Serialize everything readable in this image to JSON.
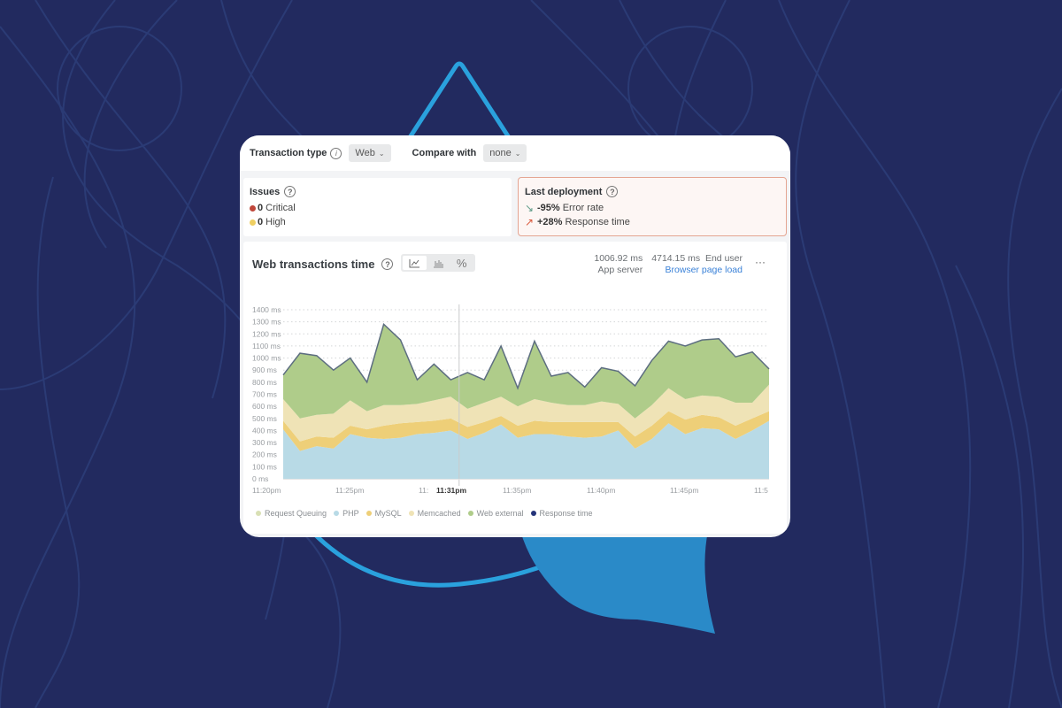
{
  "toolbar": {
    "transaction_type_label": "Transaction type",
    "transaction_type_value": "Web",
    "compare_label": "Compare with",
    "compare_value": "none"
  },
  "issues": {
    "title": "Issues",
    "items": [
      {
        "count": "0",
        "label": "Critical",
        "color": "#c0473a"
      },
      {
        "count": "0",
        "label": "High",
        "color": "#efcf62"
      }
    ]
  },
  "deployment": {
    "title": "Last deployment",
    "items": [
      {
        "arrow": "↘",
        "value": "-95%",
        "label": "Error rate",
        "color": "#5d9a86"
      },
      {
        "arrow": "↗",
        "value": "+28%",
        "label": "Response time",
        "color": "#d9593c"
      }
    ]
  },
  "chart_panel": {
    "title": "Web transactions time",
    "viz_options": [
      "line-chart-icon",
      "bar-chart-icon",
      "percent-icon"
    ],
    "metrics": [
      {
        "value": "1006.92 ms",
        "label": "App server",
        "link": false
      },
      {
        "value": "4714.15 ms  End user",
        "label": "Browser page load",
        "link": true
      }
    ],
    "more_label": "···"
  },
  "chart_data": {
    "type": "area",
    "stacked": true,
    "title": "Web transactions time",
    "ylabel": "",
    "ylim": [
      0,
      1400
    ],
    "yticks": [
      0,
      100,
      200,
      300,
      400,
      500,
      600,
      700,
      800,
      900,
      1000,
      1100,
      1200,
      1300,
      1400
    ],
    "ytick_unit": " ms",
    "xtick_labels": [
      "11:20pm",
      "11:25pm",
      "11:",
      "11:31pm",
      "11:35pm",
      "11:40pm",
      "11:45pm",
      "11:5"
    ],
    "xtick_positions": [
      0,
      5,
      10,
      10.5,
      15,
      20,
      25,
      30
    ],
    "highlight_tick": "11:31pm",
    "x_minutes": [
      0,
      1,
      2,
      3,
      4,
      5,
      6,
      7,
      8,
      9,
      10,
      11,
      12,
      13,
      14,
      15,
      16,
      17,
      18,
      19,
      20,
      21,
      22,
      23,
      24,
      25,
      26,
      27,
      28,
      29
    ],
    "grid": true,
    "series": [
      {
        "name": "Request Queuing",
        "color": "#d9e0b4",
        "values": [
          0,
          0,
          0,
          0,
          0,
          0,
          0,
          0,
          0,
          0,
          0,
          0,
          0,
          0,
          0,
          0,
          0,
          0,
          0,
          0,
          0,
          0,
          0,
          0,
          0,
          0,
          0,
          0,
          0,
          0
        ]
      },
      {
        "name": "PHP",
        "color": "#b8dae6",
        "values": [
          410,
          230,
          270,
          250,
          370,
          340,
          330,
          340,
          370,
          380,
          400,
          330,
          380,
          450,
          340,
          370,
          370,
          350,
          340,
          350,
          400,
          250,
          330,
          460,
          370,
          420,
          410,
          330,
          400,
          480
        ]
      },
      {
        "name": "MySQL",
        "color": "#eecf78",
        "values": [
          70,
          80,
          80,
          90,
          70,
          70,
          110,
          120,
          100,
          100,
          100,
          100,
          90,
          70,
          100,
          110,
          100,
          120,
          130,
          120,
          70,
          100,
          110,
          100,
          120,
          110,
          100,
          110,
          100,
          80
        ]
      },
      {
        "name": "Memcached",
        "color": "#efe3b6",
        "values": [
          180,
          190,
          180,
          200,
          210,
          150,
          170,
          150,
          150,
          170,
          180,
          150,
          160,
          160,
          160,
          180,
          160,
          140,
          140,
          170,
          150,
          150,
          170,
          190,
          170,
          160,
          170,
          190,
          130,
          220
        ]
      },
      {
        "name": "Web external",
        "color": "#afcc8a",
        "values": [
          200,
          540,
          490,
          360,
          350,
          240,
          670,
          540,
          200,
          300,
          140,
          300,
          190,
          420,
          150,
          480,
          220,
          270,
          150,
          280,
          270,
          270,
          370,
          390,
          440,
          460,
          480,
          380,
          420,
          130
        ]
      },
      {
        "name": "Response time",
        "color": "#25347a",
        "line": true,
        "values": [
          860,
          1040,
          1020,
          900,
          1000,
          800,
          1280,
          1150,
          820,
          950,
          820,
          880,
          800,
          1100,
          770,
          1140,
          850,
          880,
          760,
          920,
          890,
          770,
          980,
          1140,
          1100,
          1150,
          1160,
          1010,
          1050,
          910
        ]
      }
    ],
    "legend": [
      "Request Queuing",
      "PHP",
      "MySQL",
      "Memcached",
      "Web external",
      "Response time"
    ],
    "legend_position": "bottom-left"
  }
}
